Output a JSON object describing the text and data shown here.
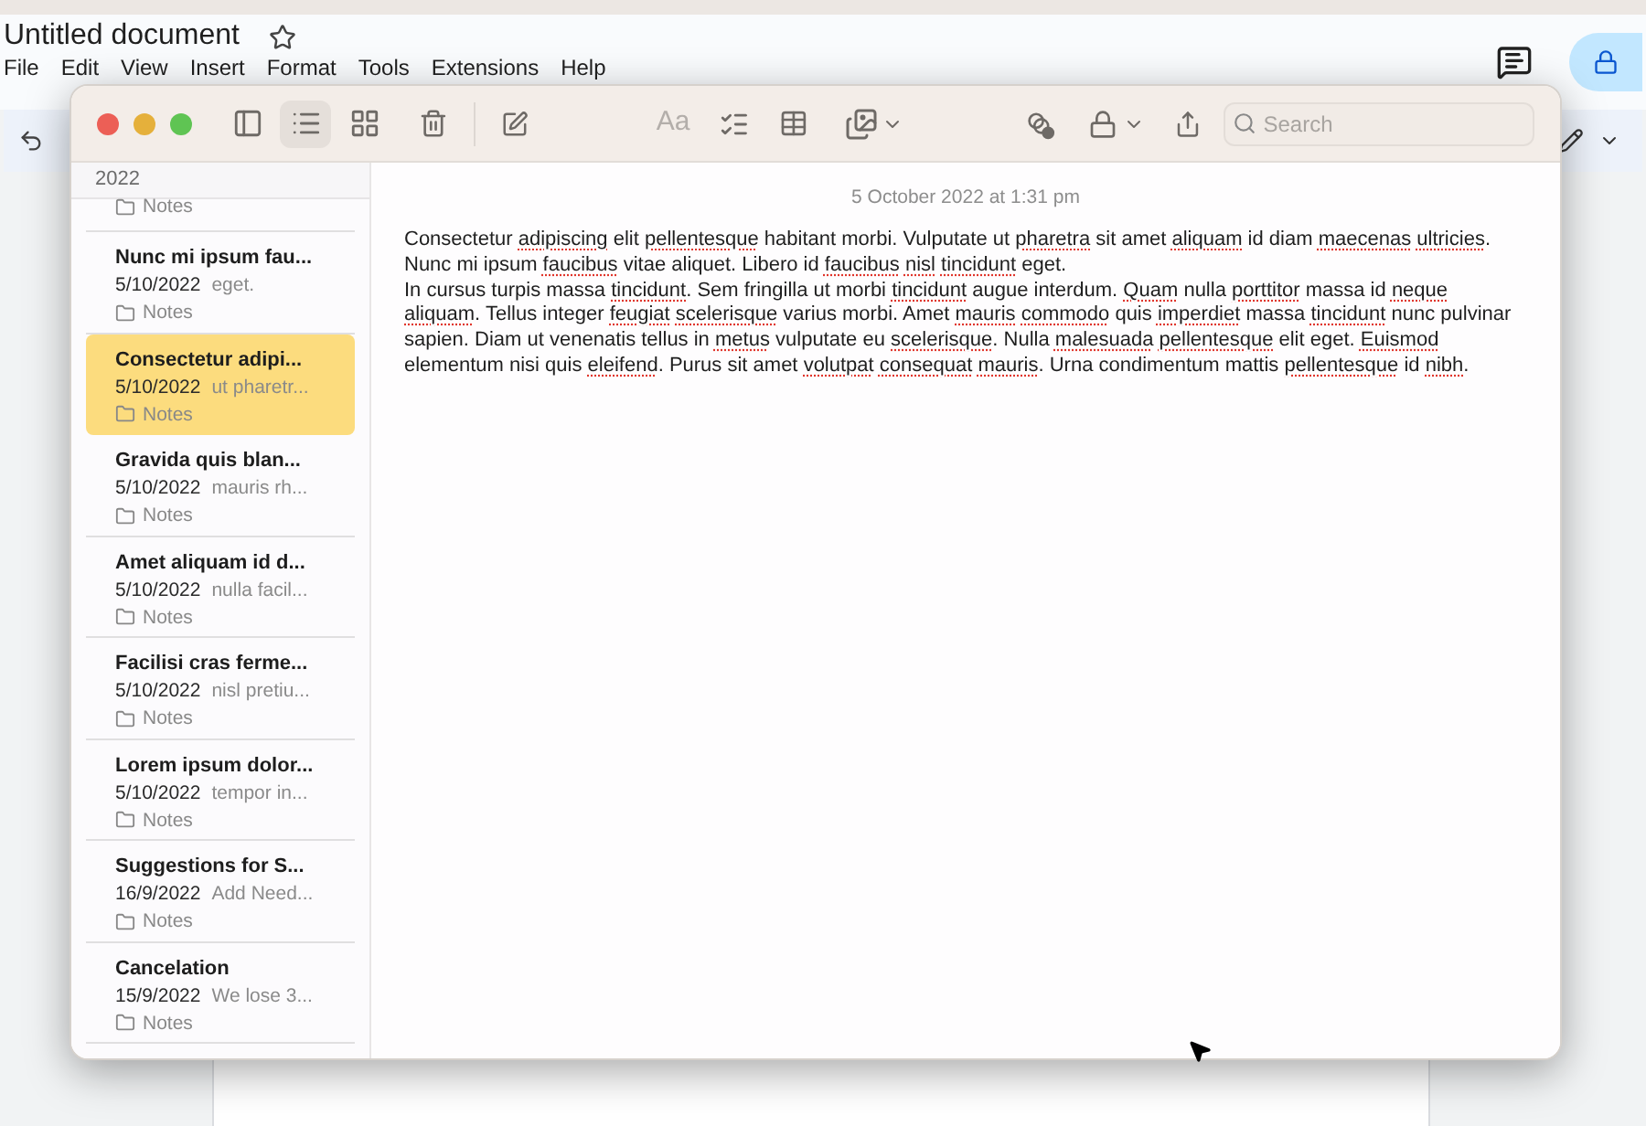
{
  "document": {
    "title": "Untitled document",
    "menu": [
      "File",
      "Edit",
      "View",
      "Insert",
      "Format",
      "Tools",
      "Extensions",
      "Help"
    ]
  },
  "notes_window": {
    "toolbar": {
      "views": [
        {
          "kind": "sidebar",
          "selected": false
        },
        {
          "kind": "list",
          "selected": true
        },
        {
          "kind": "gallery",
          "selected": false
        }
      ],
      "format_label": "Aa",
      "search": {
        "placeholder": "Search"
      }
    },
    "sidebar": {
      "section": "2022",
      "notes": [
        {
          "folder": "Notes",
          "selected": false
        },
        {
          "title": "Nunc mi ipsum fau...",
          "date": "5/10/2022",
          "preview": "eget.",
          "folder": "Notes",
          "selected": false
        },
        {
          "title": "Consectetur adipi...",
          "date": "5/10/2022",
          "preview": "ut pharetr...",
          "folder": "Notes",
          "selected": true
        },
        {
          "title": "Gravida quis blan...",
          "date": "5/10/2022",
          "preview": "mauris rh...",
          "folder": "Notes",
          "selected": false
        },
        {
          "title": "Amet aliquam id d...",
          "date": "5/10/2022",
          "preview": "nulla facil...",
          "folder": "Notes",
          "selected": false
        },
        {
          "title": "Facilisi cras ferme...",
          "date": "5/10/2022",
          "preview": "nisl pretiu...",
          "folder": "Notes",
          "selected": false
        },
        {
          "title": "Lorem ipsum dolor...",
          "date": "5/10/2022",
          "preview": "tempor in...",
          "folder": "Notes",
          "selected": false
        },
        {
          "title": "Suggestions for S...",
          "date": "16/9/2022",
          "preview": "Add Need...",
          "folder": "Notes",
          "selected": false
        },
        {
          "title": "Cancelation",
          "date": "15/9/2022",
          "preview": "We lose 3...",
          "folder": "Notes",
          "selected": false
        }
      ]
    },
    "note": {
      "timestamp": "5 October 2022 at 1:31 pm",
      "paragraphs": [
        [
          {
            "text": "Consectetur ",
            "misspelled": false
          },
          {
            "text": "adipiscing",
            "misspelled": true
          },
          {
            "text": " elit ",
            "misspelled": false
          },
          {
            "text": "pellentesque",
            "misspelled": true
          },
          {
            "text": " habitant morbi. Vulputate ut ",
            "misspelled": false
          },
          {
            "text": "pharetra",
            "misspelled": true
          },
          {
            "text": " sit amet ",
            "misspelled": false
          },
          {
            "text": "aliquam",
            "misspelled": true
          },
          {
            "text": " id diam ",
            "misspelled": false
          },
          {
            "text": "maecenas",
            "misspelled": true
          },
          {
            "text": " ultricies",
            "misspelled": true
          },
          {
            "text": ". Nunc mi ipsum ",
            "misspelled": false
          },
          {
            "text": "faucibus",
            "misspelled": true
          },
          {
            "text": " vitae aliquet. Libero id ",
            "misspelled": false
          },
          {
            "text": "faucibus",
            "misspelled": true
          },
          {
            "text": " nisl",
            "misspelled": true
          },
          {
            "text": " tincidunt",
            "misspelled": true
          },
          {
            "text": " eget.",
            "misspelled": false
          }
        ],
        [
          {
            "text": "In cursus turpis massa ",
            "misspelled": false
          },
          {
            "text": "tincidunt",
            "misspelled": true
          },
          {
            "text": ". Sem fringilla ut morbi ",
            "misspelled": false
          },
          {
            "text": "tincidunt",
            "misspelled": true
          },
          {
            "text": " augue interdum. ",
            "misspelled": false
          },
          {
            "text": "Quam",
            "misspelled": true
          },
          {
            "text": " nulla ",
            "misspelled": false
          },
          {
            "text": "porttitor",
            "misspelled": true
          },
          {
            "text": " massa id ",
            "misspelled": false
          },
          {
            "text": "neque",
            "misspelled": true
          },
          {
            "text": " aliquam",
            "misspelled": true
          },
          {
            "text": ". Tellus integer ",
            "misspelled": false
          },
          {
            "text": "feugiat",
            "misspelled": true
          },
          {
            "text": " scelerisque",
            "misspelled": true
          },
          {
            "text": " varius morbi. Amet ",
            "misspelled": false
          },
          {
            "text": "mauris",
            "misspelled": true
          },
          {
            "text": " commodo",
            "misspelled": true
          },
          {
            "text": " quis ",
            "misspelled": false
          },
          {
            "text": "imperdiet",
            "misspelled": true
          },
          {
            "text": " massa ",
            "misspelled": false
          },
          {
            "text": "tincidunt",
            "misspelled": true
          },
          {
            "text": " nunc pulvinar sapien. Diam ut venenatis tellus in ",
            "misspelled": false
          },
          {
            "text": "metus",
            "misspelled": true
          },
          {
            "text": " vulputate eu ",
            "misspelled": false
          },
          {
            "text": "scelerisque",
            "misspelled": true
          },
          {
            "text": ". Nulla ",
            "misspelled": false
          },
          {
            "text": "malesuada",
            "misspelled": true
          },
          {
            "text": " pellentesque",
            "misspelled": true
          },
          {
            "text": " elit eget. ",
            "misspelled": false
          },
          {
            "text": "Euismod",
            "misspelled": true
          },
          {
            "text": " elementum nisi quis ",
            "misspelled": false
          },
          {
            "text": "eleifend",
            "misspelled": true
          },
          {
            "text": ". Purus sit amet ",
            "misspelled": false
          },
          {
            "text": "volutpat",
            "misspelled": true
          },
          {
            "text": " consequat",
            "misspelled": true
          },
          {
            "text": " mauris",
            "misspelled": true
          },
          {
            "text": ". Urna condimentum mattis ",
            "misspelled": false
          },
          {
            "text": "pellentesque",
            "misspelled": true
          },
          {
            "text": " id ",
            "misspelled": false
          },
          {
            "text": "nibh",
            "misspelled": true
          },
          {
            "text": ".",
            "misspelled": false
          }
        ]
      ]
    }
  }
}
